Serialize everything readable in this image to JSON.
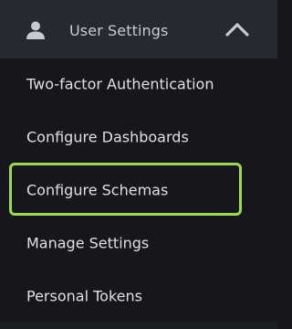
{
  "header": {
    "title": "User Settings",
    "icon": "user-icon",
    "toggle_icon": "chevron-up-icon",
    "expanded": true
  },
  "menu": {
    "items": [
      {
        "label": "Two-factor Authentication"
      },
      {
        "label": "Configure Dashboards"
      },
      {
        "label": "Configure Schemas",
        "highlighted": true
      },
      {
        "label": "Manage Settings"
      },
      {
        "label": "Personal Tokens"
      }
    ]
  },
  "colors": {
    "header_bg": "#28292e",
    "panel_bg": "#17171b",
    "text": "#dfe0e5",
    "header_text": "#c9cad0",
    "highlight": "#9bdc4a"
  }
}
